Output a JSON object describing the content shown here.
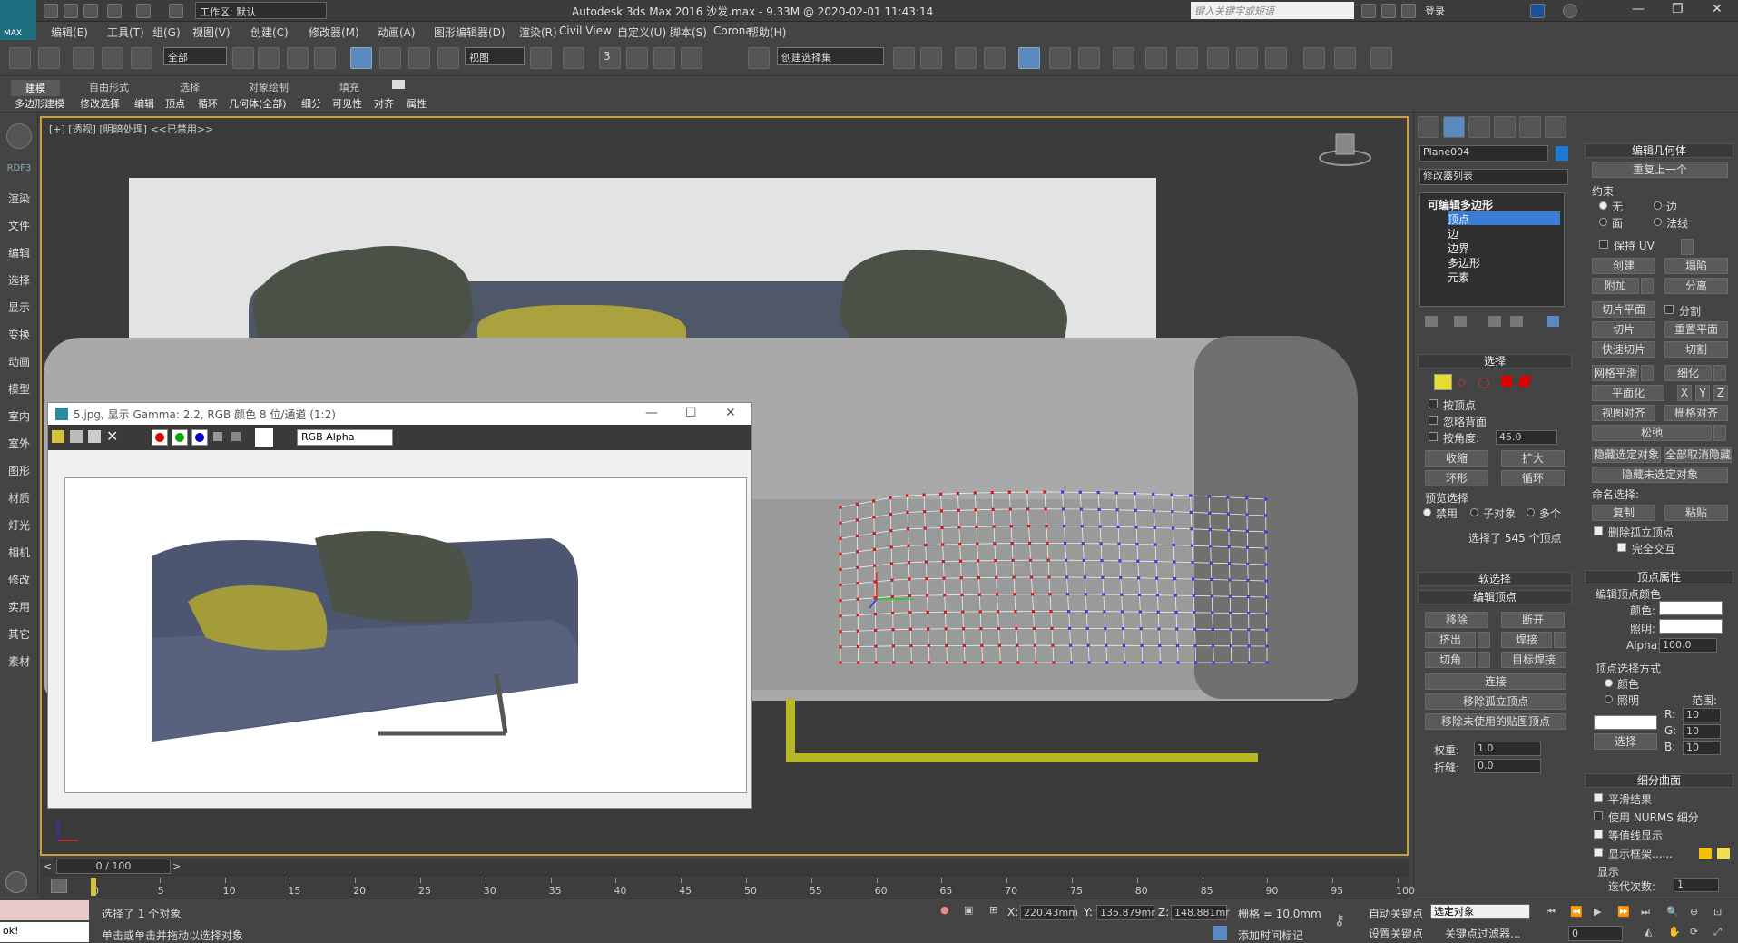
{
  "app": {
    "logo_text": "MAX",
    "workspace": "工作区: 默认",
    "title": "Autodesk 3ds Max 2016     沙发.max - 9.33M @ 2020-02-01 11:43:14",
    "keyword_search_placeholder": "键入关键字或短语",
    "login": "登录"
  },
  "menu": [
    "编辑(E)",
    "工具(T)",
    "组(G)",
    "视图(V)",
    "创建(C)",
    "修改器(M)",
    "动画(A)",
    "图形编辑器(D)",
    "渲染(R)",
    "Civil View",
    "自定义(U)",
    "脚本(S)",
    "Corona",
    "帮助(H)"
  ],
  "toolbar": {
    "filter_select": "全部",
    "ref_coord": "视图",
    "named_selection": "创建选择集",
    "snap_label": "3"
  },
  "ribbon": {
    "tabs": [
      "建模",
      "自由形式",
      "选择",
      "对象绘制",
      "填充"
    ],
    "items": [
      "多边形建模",
      "修改选择",
      "编辑",
      "顶点",
      "循环",
      "几何体(全部)",
      "细分",
      "可见性",
      "对齐",
      "属性"
    ]
  },
  "leftbar": [
    "RDF3",
    "渲染",
    "文件",
    "编辑",
    "选择",
    "显示",
    "变换",
    "动画",
    "模型",
    "室内",
    "室外",
    "图形",
    "材质",
    "灯光",
    "相机",
    "修改",
    "实用",
    "其它",
    "素材"
  ],
  "viewport": {
    "label": "[+] [透视] [明暗处理]  <<已禁用>>"
  },
  "image_window": {
    "title": "5.jpg, 显示 Gamma: 2.2, RGB 颜色 8 位/通道 (1:2)",
    "channel_select": "RGB Alpha"
  },
  "cmd_panel": {
    "object_name": "Plane004",
    "object_color": "#1a7ad4",
    "modifier_list": "修改器列表",
    "stack": [
      "可编辑多边形",
      "顶点",
      "边",
      "边界",
      "多边形",
      "元素"
    ],
    "selection": {
      "header": "选择",
      "by_vertex": "按顶点",
      "ignore_backfacing": "忽略背面",
      "by_angle": "按角度:",
      "angle_value": "45.0",
      "shrink": "收缩",
      "grow": "扩大",
      "ring": "环形",
      "loop": "循环",
      "preview": "预览选择",
      "disabled": "禁用",
      "sub_object": "子对象",
      "multi": "多个",
      "status": "选择了 545 个顶点"
    },
    "soft_selection": "软选择",
    "edit_vertices": {
      "header": "编辑顶点",
      "remove": "移除",
      "break": "断开",
      "extrude": "挤出",
      "weld": "焊接",
      "chamfer": "切角",
      "target_weld": "目标焊接",
      "connect": "连接",
      "remove_isolated": "移除孤立顶点",
      "remove_unused": "移除未使用的贴图顶点",
      "weight_label": "权重:",
      "weight_value": "1.0",
      "crease_label": "折缝:",
      "crease_value": "0.0"
    },
    "edit_geometry": {
      "header": "编辑几何体",
      "repeat_last": "重复上一个",
      "constraints": "约束",
      "none": "无",
      "edge": "边",
      "face": "面",
      "normal": "法线",
      "preserve_uv": "保持 UV",
      "create": "创建",
      "collapse": "塌陷",
      "attach": "附加",
      "detach": "分离",
      "slice_plane": "切片平面",
      "split": "分割",
      "slice": "切片",
      "reset_plane": "重置平面",
      "quickslice": "快速切片",
      "cut": "切割",
      "meshsmooth": "网格平滑",
      "tessellate": "细化",
      "planarize": "平面化",
      "x": "X",
      "y": "Y",
      "z": "Z",
      "view_align": "视图对齐",
      "grid_align": "栅格对齐",
      "relax": "松弛",
      "hide_selected": "隐藏选定对象",
      "unhide_all": "全部取消隐藏",
      "hide_unselected": "隐藏未选定对象",
      "named_sel": "命名选择:",
      "copy": "复制",
      "paste": "粘贴",
      "delete_isolated": "删除孤立顶点",
      "full_interactivity": "完全交互"
    },
    "vertex_props": {
      "header": "顶点属性",
      "edit_color": "编辑顶点颜色",
      "color": "颜色:",
      "illum": "照明:",
      "alpha": "Alpha:",
      "alpha_value": "100.0",
      "select_by": "顶点选择方式",
      "by_color": "颜色",
      "by_illum": "照明",
      "range": "范围:",
      "r": "R:",
      "g": "G:",
      "b": "B:",
      "rv": "10",
      "gv": "10",
      "bv": "10",
      "select": "选择"
    },
    "subdiv": {
      "header": "细分曲面",
      "smooth_result": "平滑结果",
      "use_nurms": "使用 NURMS 细分",
      "isoline": "等值线显示",
      "show_cage": "显示框架......",
      "display": "显示",
      "iterations_label": "迭代次数:",
      "iterations": "1"
    }
  },
  "timeline": {
    "frame": "0 / 100",
    "ticks": [
      "0",
      "5",
      "10",
      "15",
      "20",
      "25",
      "30",
      "35",
      "40",
      "45",
      "50",
      "55",
      "60",
      "65",
      "70",
      "75",
      "80",
      "85",
      "90",
      "95",
      "100"
    ]
  },
  "status": {
    "maxscript": "ok!",
    "selected": "选择了 1 个对象",
    "prompt": "单击或单击并拖动以选择对象",
    "x_label": "X:",
    "x": "220.43mm",
    "y_label": "Y:",
    "y": "135.879mr",
    "z_label": "Z:",
    "z": "148.881mr",
    "grid": "栅格 = 10.0mm",
    "autokey": "自动关键点",
    "set_key": "设置关键点",
    "selected_obj": "选定对象",
    "key_filter": "关键点过滤器...",
    "add_time_tag": "添加时间标记",
    "current_frame": "0"
  }
}
